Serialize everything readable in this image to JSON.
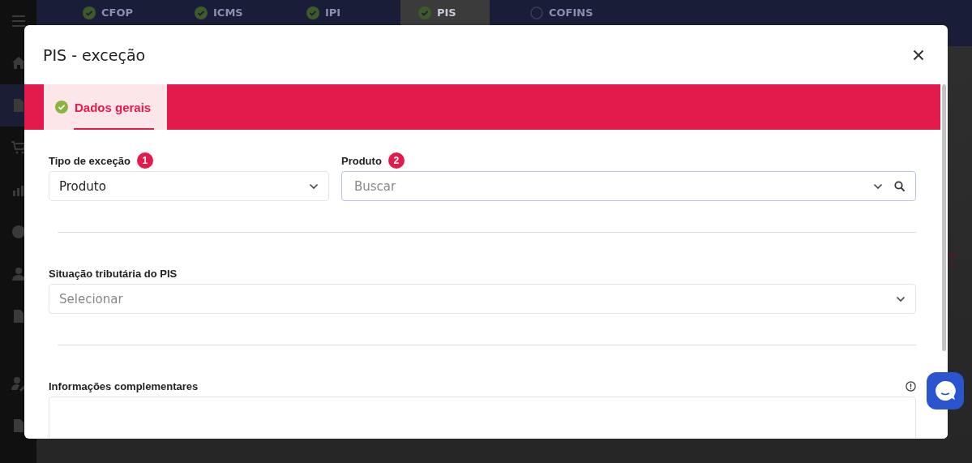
{
  "background": {
    "tabs": [
      {
        "label": "CFOP",
        "done": true,
        "selected": false
      },
      {
        "label": "ICMS",
        "done": true,
        "selected": false
      },
      {
        "label": "IPI",
        "done": true,
        "selected": false
      },
      {
        "label": "PIS",
        "done": true,
        "selected": true
      },
      {
        "label": "COFINS",
        "done": false,
        "selected": false
      }
    ]
  },
  "dialog": {
    "title": "PIS - exceção",
    "tabs": [
      {
        "label": "Dados gerais",
        "done": true,
        "selected": true
      }
    ],
    "rows": [
      [
        {
          "kind": "select",
          "label": "Tipo de exceção",
          "badge": "1",
          "value": "Produto"
        },
        {
          "kind": "search",
          "label": "Produto",
          "badge": "2",
          "placeholder": "Buscar"
        }
      ],
      [
        {
          "kind": "select",
          "label": "Situação tributária do PIS",
          "placeholder": "Selecionar"
        }
      ],
      [
        {
          "kind": "textarea",
          "label": "Informações complementares",
          "info": true
        }
      ]
    ]
  }
}
